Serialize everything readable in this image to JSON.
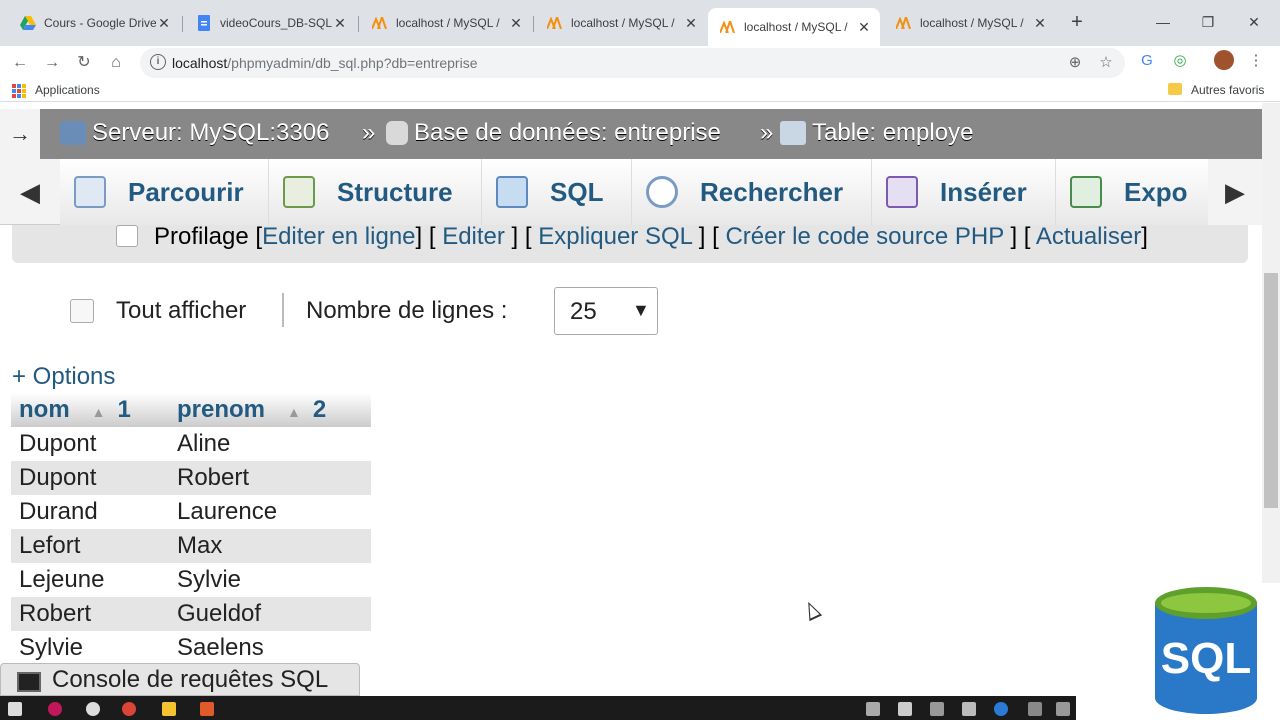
{
  "browser": {
    "tabs": [
      {
        "title": "Cours - Google Drive",
        "favicon": "google-drive-icon",
        "active": false
      },
      {
        "title": "videoCours_DB-SQL",
        "favicon": "google-docs-icon",
        "active": false
      },
      {
        "title": "localhost / MySQL / ",
        "favicon": "phpmyadmin-icon",
        "active": false
      },
      {
        "title": "localhost / MySQL / ",
        "favicon": "phpmyadmin-icon",
        "active": false
      },
      {
        "title": "localhost / MySQL / ",
        "favicon": "phpmyadmin-icon",
        "active": true
      },
      {
        "title": "localhost / MySQL / ",
        "favicon": "phpmyadmin-icon",
        "active": false
      }
    ],
    "new_tab": "+",
    "url_host": "localhost",
    "url_path": "/phpmyadmin/db_sql.php?db=entreprise",
    "bookmarks": {
      "apps_label": "Applications",
      "other_label": "Autres favoris"
    }
  },
  "breadcrumb": {
    "arrow": "→",
    "server": "Serveur: MySQL:3306",
    "database": "Base de données: entreprise",
    "table": "Table: employe",
    "separator": "»"
  },
  "menu": {
    "tabs": [
      {
        "label": "Parcourir",
        "icon": "browse-icon"
      },
      {
        "label": "Structure",
        "icon": "structure-icon"
      },
      {
        "label": "SQL",
        "icon": "sql-icon"
      },
      {
        "label": "Rechercher",
        "icon": "search-icon"
      },
      {
        "label": "Insérer",
        "icon": "insert-icon"
      },
      {
        "label": "Expo",
        "icon": "export-icon"
      }
    ]
  },
  "profile": {
    "label": "Profilage",
    "links": [
      "Editer en ligne",
      "Editer",
      "Expliquer SQL",
      "Créer le code source PHP",
      "Actualiser"
    ]
  },
  "navigation": {
    "show_all_label": "Tout afficher",
    "rows_label": "Nombre de lignes :",
    "rows_value": "25"
  },
  "options_link": "+ Options",
  "results": {
    "columns": [
      {
        "name": "nom",
        "order": "1"
      },
      {
        "name": "prenom",
        "order": "2"
      }
    ],
    "rows": [
      [
        "Dupont",
        "Aline"
      ],
      [
        "Dupont",
        "Robert"
      ],
      [
        "Durand",
        "Laurence"
      ],
      [
        "Lefort",
        "Max"
      ],
      [
        "Lejeune",
        "Sylvie"
      ],
      [
        "Robert",
        "Gueldof"
      ],
      [
        "Sylvie",
        "Saelens"
      ]
    ]
  },
  "console": {
    "label": "Console de requêtes SQL"
  },
  "logo": {
    "text": "SQL"
  },
  "colors": {
    "link": "#235a81",
    "breadcrumb_bg": "#888888",
    "logo_blue": "#2a78c8",
    "logo_green": "#8dc63f"
  }
}
